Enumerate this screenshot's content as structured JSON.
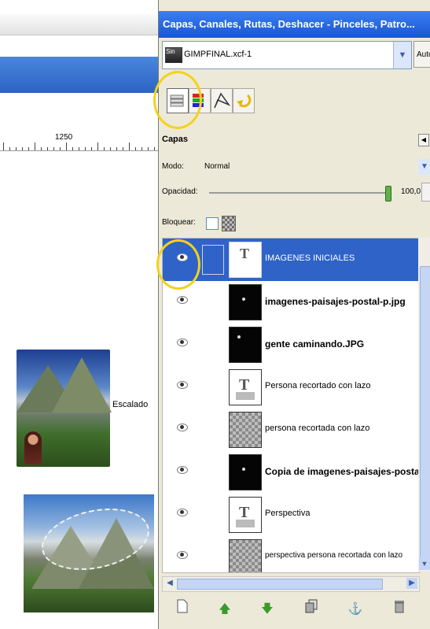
{
  "canvas": {
    "ruler_number": "1250",
    "caption": "Escalado"
  },
  "dock": {
    "title": "Capas, Canales, Rutas, Deshacer - Pinceles, Patro...",
    "image_selector": {
      "thumb_text": "Sin",
      "value": "GIMPFINAL.xcf-1"
    },
    "auto_button": "Auto",
    "tabs": [
      "layers-tab-icon",
      "channels-tab-icon",
      "paths-tab-icon",
      "undo-tab-icon"
    ],
    "panel_title": "Capas",
    "mode": {
      "label": "Modo:",
      "value": "Normal"
    },
    "opacity": {
      "label": "Opacidad:",
      "value": "100,0",
      "level": 1.0
    },
    "lock": {
      "label": "Bloquear:"
    },
    "layers": [
      {
        "name": "IMAGENES INICIALES",
        "thumb": "group",
        "bold": false,
        "selected": true
      },
      {
        "name": "imagenes-paisajes-postal-p.jpg",
        "thumb": "black",
        "bold": true,
        "selected": false
      },
      {
        "name": "gente caminando.JPG",
        "thumb": "black",
        "bold": true,
        "selected": false
      },
      {
        "name": "Persona recortado con lazo",
        "thumb": "text",
        "bold": false,
        "selected": false
      },
      {
        "name": "persona recortada con lazo",
        "thumb": "checker",
        "bold": false,
        "selected": false
      },
      {
        "name": "Copia de imagenes-paisajes-posta",
        "thumb": "black",
        "bold": true,
        "selected": false
      },
      {
        "name": "Perspectiva",
        "thumb": "text",
        "bold": false,
        "selected": false
      },
      {
        "name": "perspectiva persona recortada con lazo",
        "thumb": "checker",
        "bold": false,
        "selected": false
      }
    ],
    "bottom_toolbar": [
      "new-layer-icon",
      "raise-layer-icon",
      "lower-layer-icon",
      "duplicate-layer-icon",
      "anchor-layer-icon",
      "delete-layer-icon"
    ]
  },
  "colors": {
    "title_blue": "#1a55d4",
    "selection_blue": "#2f63c7",
    "highlight_circle": "#f5d11c"
  }
}
